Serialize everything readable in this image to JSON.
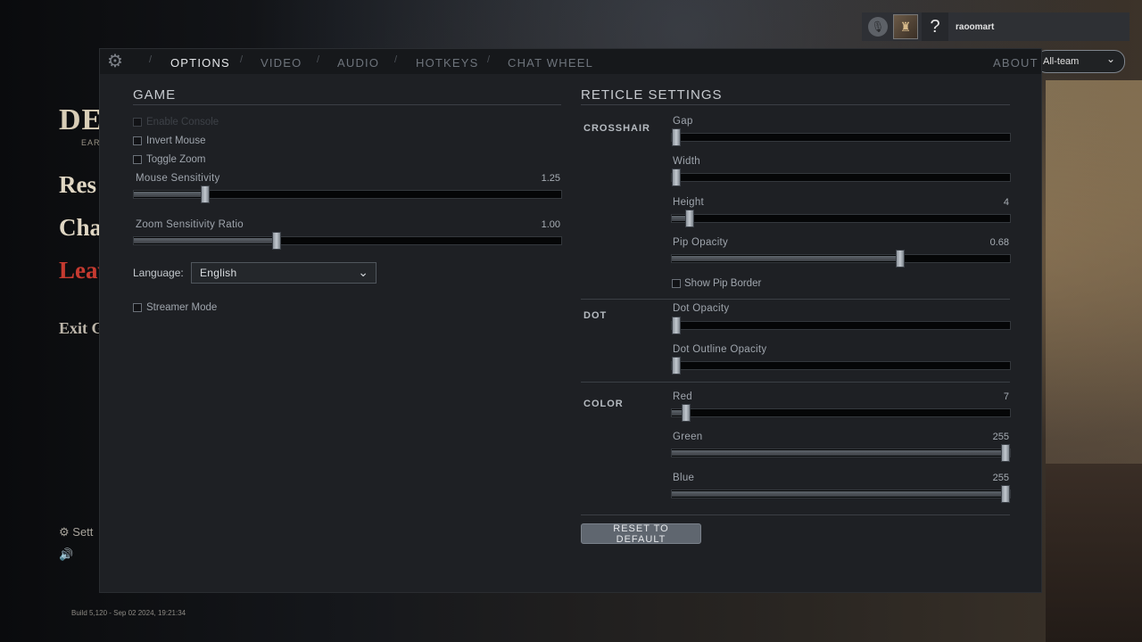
{
  "background": {
    "logo": "DE",
    "logo_sub": "EARL",
    "menu": [
      "Res",
      "Cha",
      "Leav",
      "Exit G"
    ],
    "settings_label": "Sett",
    "build": "Build 5,120 - Sep 02 2024, 19:21:34"
  },
  "user": {
    "name": "raoomart",
    "help": "?",
    "chat_channel": "All-team"
  },
  "tabs": [
    {
      "label": "OPTIONS",
      "active": true
    },
    {
      "label": "VIDEO",
      "active": false
    },
    {
      "label": "AUDIO",
      "active": false
    },
    {
      "label": "HOTKEYS",
      "active": false
    },
    {
      "label": "CHAT WHEEL",
      "active": false
    }
  ],
  "about_label": "ABOUT",
  "game": {
    "title": "GAME",
    "enable_console": "Enable Console",
    "invert_mouse": "Invert Mouse",
    "toggle_zoom": "Toggle Zoom",
    "mouse_sensitivity": {
      "label": "Mouse Sensitivity",
      "value": "1.25",
      "fraction": 0.16
    },
    "zoom_sensitivity": {
      "label": "Zoom Sensitivity Ratio",
      "value": "1.00",
      "fraction": 0.33
    },
    "language_label": "Language:",
    "language_value": "English",
    "streamer_mode": "Streamer Mode"
  },
  "reticle": {
    "title": "RETICLE SETTINGS",
    "crosshair_label": "CROSSHAIR",
    "gap": {
      "label": "Gap",
      "value": "",
      "fraction": 0.0
    },
    "width": {
      "label": "Width",
      "value": "",
      "fraction": 0.0
    },
    "height": {
      "label": "Height",
      "value": "4",
      "fraction": 0.04
    },
    "pip_opacity": {
      "label": "Pip Opacity",
      "value": "0.68",
      "fraction": 0.68
    },
    "show_pip_border": "Show Pip Border",
    "dot_label": "DOT",
    "dot_opacity": {
      "label": "Dot Opacity",
      "value": "",
      "fraction": 0.0
    },
    "dot_outline_opacity": {
      "label": "Dot Outline Opacity",
      "value": "",
      "fraction": 0.0
    },
    "color_label": "COLOR",
    "red": {
      "label": "Red",
      "value": "7",
      "fraction": 0.03
    },
    "green": {
      "label": "Green",
      "value": "255",
      "fraction": 1.0
    },
    "blue": {
      "label": "Blue",
      "value": "255",
      "fraction": 1.0
    },
    "reset_label": "RESET TO DEFAULT"
  }
}
